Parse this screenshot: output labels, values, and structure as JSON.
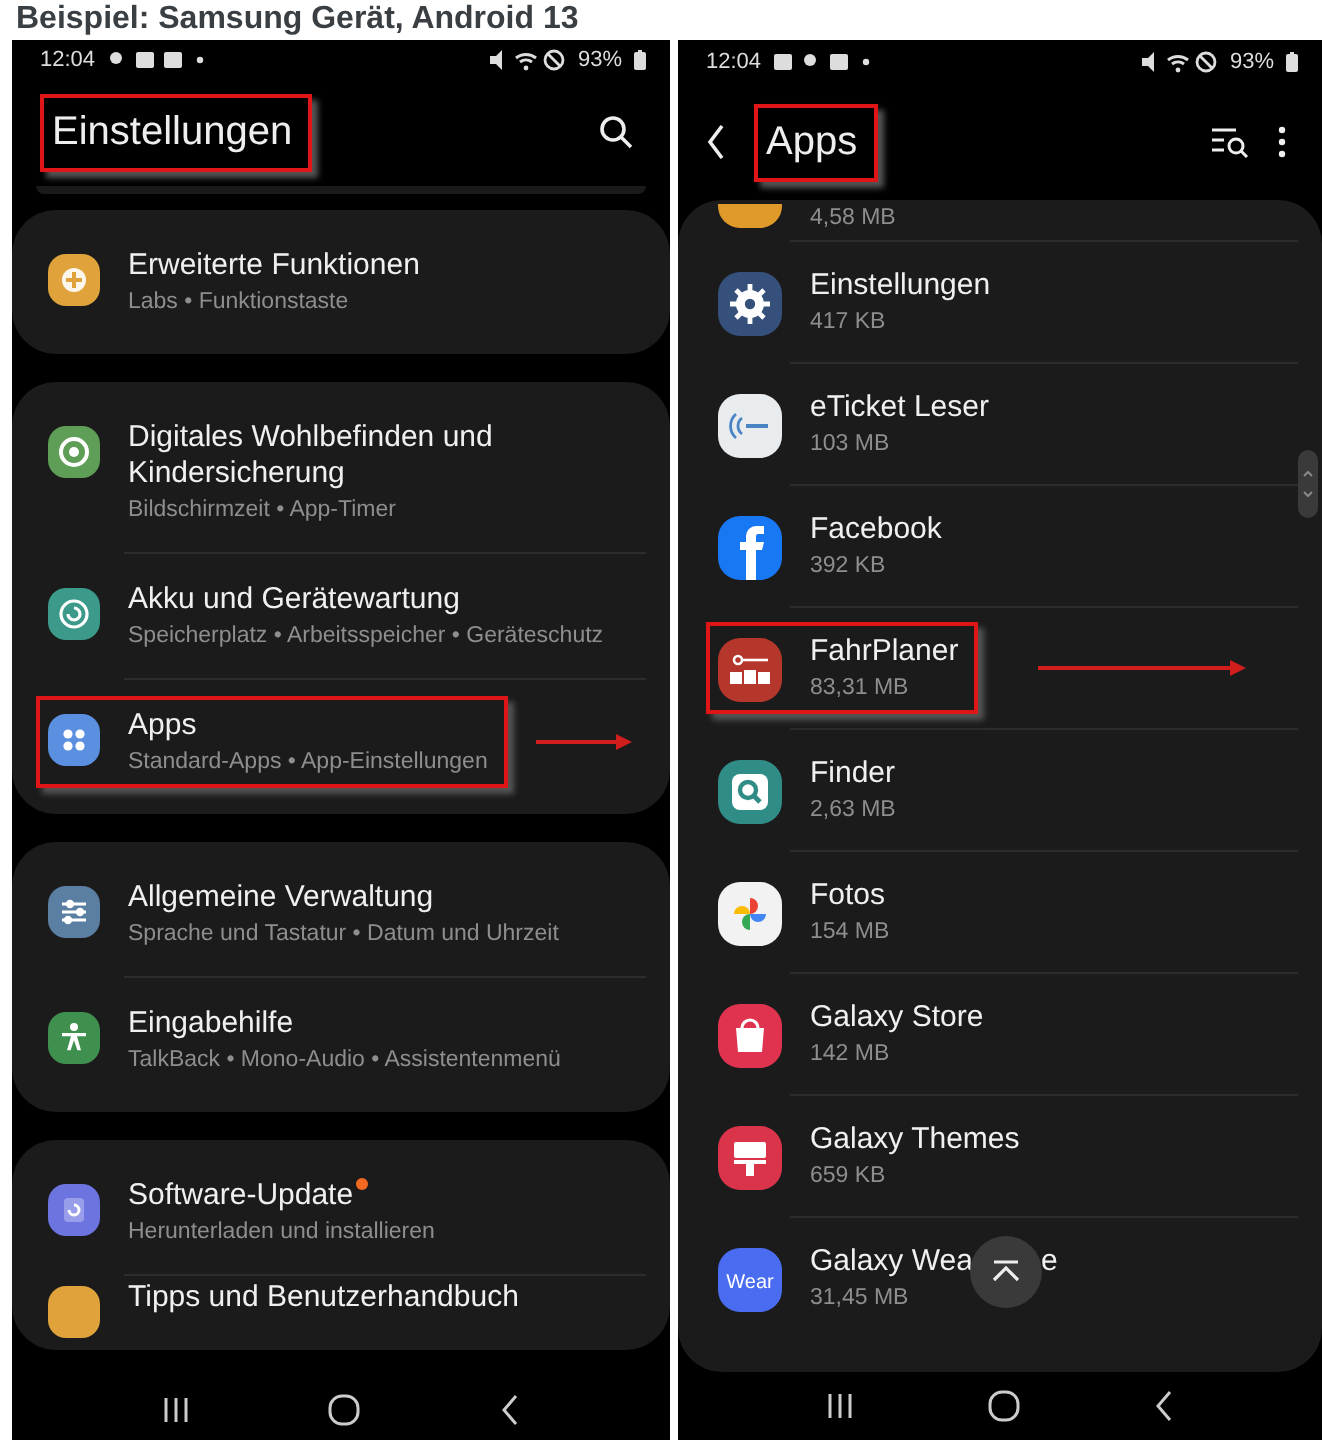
{
  "heading": "Beispiel: Samsung Gerät, Android 13",
  "left_screen": {
    "status_bar": {
      "time": "12:04",
      "battery": "93%"
    },
    "title": "Einstellungen",
    "title_highlighted": true,
    "groups": [
      [
        {
          "title": "Erweiterte Funktionen",
          "subtitle": "Labs • Funktionstaste",
          "highlighted": false,
          "badge": false
        }
      ],
      [
        {
          "title": "Digitales Wohlbefinden und Kindersicherung",
          "subtitle": "Bildschirmzeit • App-Timer",
          "highlighted": false,
          "badge": false
        },
        {
          "title": "Akku und Gerätewartung",
          "subtitle": "Speicherplatz • Arbeitsspeicher • Geräteschutz",
          "highlighted": false,
          "badge": false
        },
        {
          "title": "Apps",
          "subtitle": "Standard-Apps • App-Einstellungen",
          "highlighted": true,
          "badge": false
        }
      ],
      [
        {
          "title": "Allgemeine Verwaltung",
          "subtitle": "Sprache und Tastatur • Datum und Uhrzeit",
          "highlighted": false,
          "badge": false
        },
        {
          "title": "Eingabehilfe",
          "subtitle": "TalkBack • Mono-Audio • Assistentenmenü",
          "highlighted": false,
          "badge": false
        }
      ],
      [
        {
          "title": "Software-Update",
          "subtitle": "Herunterladen und installieren",
          "highlighted": false,
          "badge": true
        },
        {
          "title": "Tipps und Benutzerhandbuch",
          "highlighted": false,
          "badge": false
        }
      ]
    ]
  },
  "right_screen": {
    "status_bar": {
      "time": "12:04",
      "battery": "93%"
    },
    "title": "Apps",
    "title_highlighted": true,
    "apps": [
      {
        "size": "4,58 MB",
        "highlighted": false
      },
      {
        "name": "Einstellungen",
        "size": "417 KB",
        "highlighted": false
      },
      {
        "name": "eTicket Leser",
        "size": "103 MB",
        "highlighted": false
      },
      {
        "name": "Facebook",
        "size": "392 KB",
        "highlighted": false
      },
      {
        "name": "FahrPlaner",
        "size": "83,31 MB",
        "highlighted": true
      },
      {
        "name": "Finder",
        "size": "2,63 MB",
        "highlighted": false
      },
      {
        "name": "Fotos",
        "size": "154 MB",
        "highlighted": false
      },
      {
        "name": "Galaxy Store",
        "size": "142 MB",
        "highlighted": false
      },
      {
        "name": "Galaxy Themes",
        "size": "659 KB",
        "highlighted": false
      },
      {
        "name": "Galaxy Wea",
        "name_after_overlay": "e",
        "size": "31,45 MB",
        "highlighted": false,
        "icon_label": "Wear"
      }
    ]
  }
}
